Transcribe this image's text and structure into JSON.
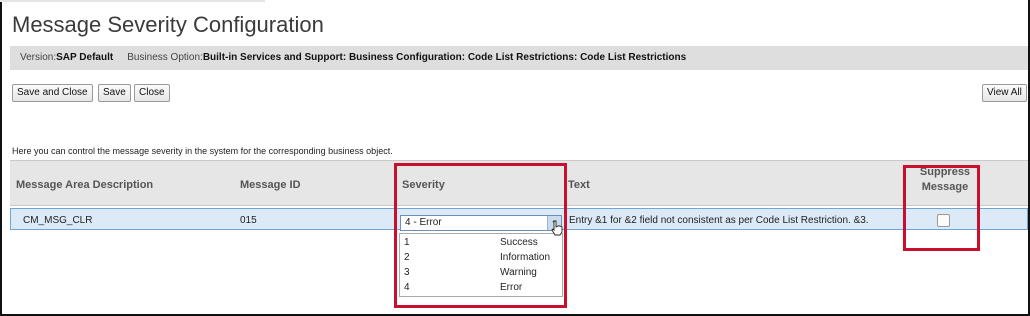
{
  "page": {
    "title": "Message Severity Configuration"
  },
  "info": {
    "version_label": "Version:",
    "version_value": "SAP Default",
    "business_label": "Business Option:",
    "business_value": "Built-in Services and Support: Business Configuration: Code List Restrictions: Code List Restrictions"
  },
  "toolbar": {
    "save_and_close": "Save and Close",
    "save": "Save",
    "close": "Close",
    "view_all": "View All"
  },
  "help_text": "Here you can control the message severity in the system for the corresponding business object.",
  "table": {
    "columns": {
      "area": "Message Area Description",
      "id": "Message ID",
      "severity": "Severity",
      "text": "Text",
      "suppress_line1": "Suppress",
      "suppress_line2": "Message"
    },
    "row": {
      "area": "CM_MSG_CLR",
      "id": "015",
      "severity": "4 - Error",
      "text": "Entry &1 for &2 field not consistent as per Code List Restriction. &3.",
      "suppress": false
    }
  },
  "severity_options": [
    {
      "key": "1",
      "label": "Success"
    },
    {
      "key": "2",
      "label": "Information"
    },
    {
      "key": "3",
      "label": "Warning"
    },
    {
      "key": "4",
      "label": "Error"
    }
  ],
  "colors": {
    "highlight": "#c8102e",
    "row_selected": "#dce9f6",
    "header_bg": "#e6e6e6"
  }
}
